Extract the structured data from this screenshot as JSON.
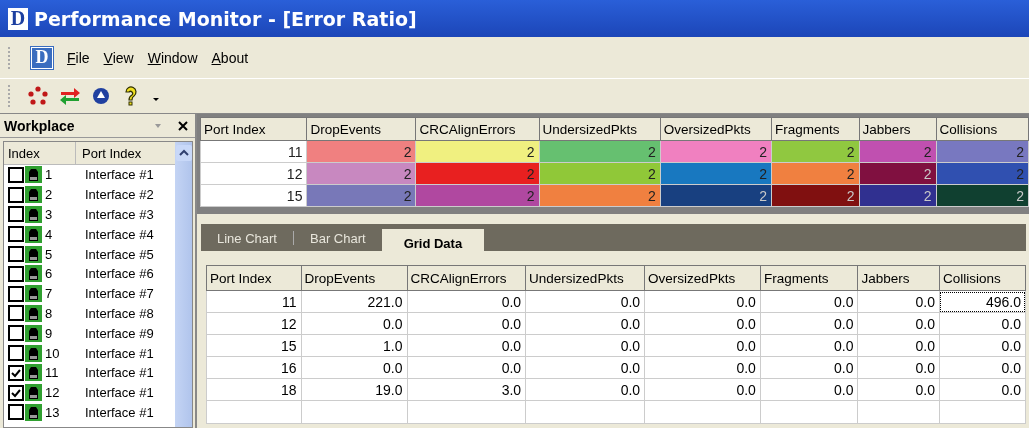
{
  "window": {
    "logo": "D",
    "title": "Performance Monitor - [Error Ratio]"
  },
  "menu_logo": "D",
  "menu": [
    "File",
    "View",
    "Window",
    "About"
  ],
  "workplace": {
    "title": "Workplace",
    "columns": [
      "Index",
      "Port Index"
    ],
    "items": [
      {
        "index": "1",
        "name": "Interface #1",
        "checked": false
      },
      {
        "index": "2",
        "name": "Interface #2",
        "checked": false
      },
      {
        "index": "3",
        "name": "Interface #3",
        "checked": false
      },
      {
        "index": "4",
        "name": "Interface #4",
        "checked": false
      },
      {
        "index": "5",
        "name": "Interface #5",
        "checked": false
      },
      {
        "index": "6",
        "name": "Interface #6",
        "checked": false
      },
      {
        "index": "7",
        "name": "Interface #7",
        "checked": false
      },
      {
        "index": "8",
        "name": "Interface #8",
        "checked": false
      },
      {
        "index": "9",
        "name": "Interface #9",
        "checked": false
      },
      {
        "index": "10",
        "name": "Interface #1",
        "checked": false
      },
      {
        "index": "11",
        "name": "Interface #1",
        "checked": true
      },
      {
        "index": "12",
        "name": "Interface #1",
        "checked": true
      },
      {
        "index": "13",
        "name": "Interface #1",
        "checked": false
      }
    ]
  },
  "color_table": {
    "columns": [
      "Port Index",
      "DropEvents",
      "CRCAlignErrors",
      "UndersizedPkts",
      "OversizedPkts",
      "Fragments",
      "Jabbers",
      "Collisions"
    ],
    "rows": [
      {
        "cells": [
          {
            "value": "11",
            "color": "#ffffff"
          },
          {
            "value": "2",
            "color": "#f08080"
          },
          {
            "value": "2",
            "color": "#f0f080"
          },
          {
            "value": "2",
            "color": "#66c070"
          },
          {
            "value": "2",
            "color": "#f080c0"
          },
          {
            "value": "2",
            "color": "#90c840"
          },
          {
            "value": "2",
            "color": "#c050b0"
          },
          {
            "value": "2",
            "color": "#7878c0"
          }
        ]
      },
      {
        "cells": [
          {
            "value": "12",
            "color": "#ffffff"
          },
          {
            "value": "2",
            "color": "#c888c0"
          },
          {
            "value": "2",
            "color": "#e82020"
          },
          {
            "value": "2",
            "color": "#90c838"
          },
          {
            "value": "2",
            "color": "#1878c0"
          },
          {
            "value": "2",
            "color": "#f08040"
          },
          {
            "value": "2",
            "color": "#801040"
          },
          {
            "value": "2",
            "color": "#3050b0"
          }
        ]
      },
      {
        "cells": [
          {
            "value": "15",
            "color": "#ffffff"
          },
          {
            "value": "2",
            "color": "#7878b8"
          },
          {
            "value": "2",
            "color": "#b048a0"
          },
          {
            "value": "2",
            "color": "#f08040"
          },
          {
            "value": "2",
            "color": "#184080"
          },
          {
            "value": "2",
            "color": "#801010"
          },
          {
            "value": "2",
            "color": "#303090"
          },
          {
            "value": "2",
            "color": "#104030"
          }
        ]
      }
    ]
  },
  "tabs": [
    {
      "label": "Line Chart",
      "selected": false
    },
    {
      "label": "Bar Chart",
      "selected": false
    },
    {
      "label": "Grid Data",
      "selected": true
    }
  ],
  "grid": {
    "columns": [
      "Port Index",
      "DropEvents",
      "CRCAlignErrors",
      "UndersizedPkts",
      "OversizedPkts",
      "Fragments",
      "Jabbers",
      "Collisions"
    ],
    "rows": [
      [
        {
          "text": "11",
          "focused": false
        },
        {
          "text": "221.0",
          "focused": false
        },
        {
          "text": "0.0",
          "focused": false
        },
        {
          "text": "0.0",
          "focused": false
        },
        {
          "text": "0.0",
          "focused": false
        },
        {
          "text": "0.0",
          "focused": false
        },
        {
          "text": "0.0",
          "focused": false
        },
        {
          "text": "496.0",
          "focused": true
        }
      ],
      [
        {
          "text": "12",
          "focused": false
        },
        {
          "text": "0.0",
          "focused": false
        },
        {
          "text": "0.0",
          "focused": false
        },
        {
          "text": "0.0",
          "focused": false
        },
        {
          "text": "0.0",
          "focused": false
        },
        {
          "text": "0.0",
          "focused": false
        },
        {
          "text": "0.0",
          "focused": false
        },
        {
          "text": "0.0",
          "focused": false
        }
      ],
      [
        {
          "text": "15",
          "focused": false
        },
        {
          "text": "1.0",
          "focused": false
        },
        {
          "text": "0.0",
          "focused": false
        },
        {
          "text": "0.0",
          "focused": false
        },
        {
          "text": "0.0",
          "focused": false
        },
        {
          "text": "0.0",
          "focused": false
        },
        {
          "text": "0.0",
          "focused": false
        },
        {
          "text": "0.0",
          "focused": false
        }
      ],
      [
        {
          "text": "16",
          "focused": false
        },
        {
          "text": "0.0",
          "focused": false
        },
        {
          "text": "0.0",
          "focused": false
        },
        {
          "text": "0.0",
          "focused": false
        },
        {
          "text": "0.0",
          "focused": false
        },
        {
          "text": "0.0",
          "focused": false
        },
        {
          "text": "0.0",
          "focused": false
        },
        {
          "text": "0.0",
          "focused": false
        }
      ],
      [
        {
          "text": "18",
          "focused": false
        },
        {
          "text": "19.0",
          "focused": false
        },
        {
          "text": "3.0",
          "focused": false
        },
        {
          "text": "0.0",
          "focused": false
        },
        {
          "text": "0.0",
          "focused": false
        },
        {
          "text": "0.0",
          "focused": false
        },
        {
          "text": "0.0",
          "focused": false
        },
        {
          "text": "0.0",
          "focused": false
        }
      ]
    ]
  }
}
